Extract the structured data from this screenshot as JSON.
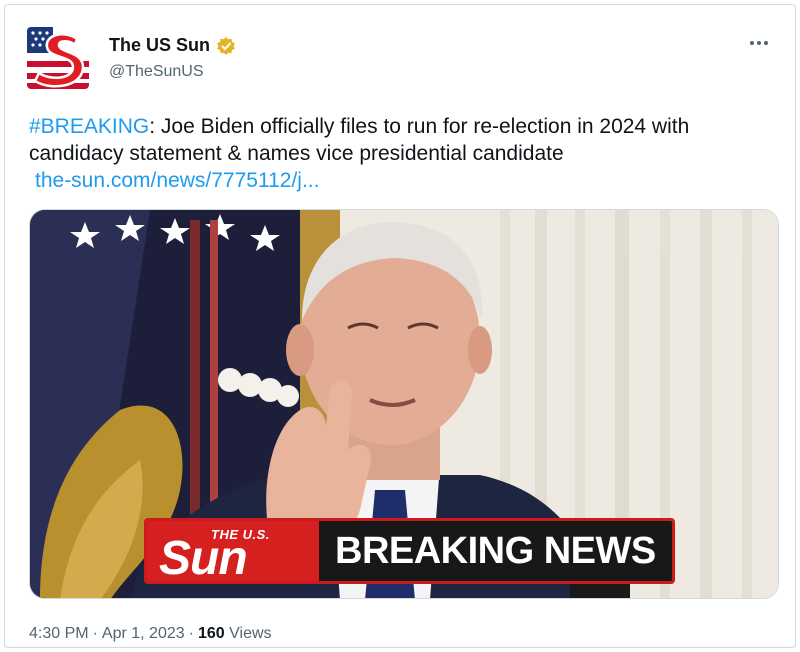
{
  "author": {
    "name": "The US Sun",
    "handle": "@TheSunUS",
    "verified_color": "#f4c542"
  },
  "tweet": {
    "hashtag": "#BREAKING",
    "text": ": Joe Biden officially files to run for re-election in 2024 with candidacy statement & names vice presidential candidate",
    "link": "the-sun.com/news/7775112/j..."
  },
  "media": {
    "banner_logo_small": "THE U.S.",
    "banner_logo_big": "Sun",
    "banner_text": "BREAKING NEWS"
  },
  "meta": {
    "time": "4:30 PM",
    "date": "Apr 1, 2023",
    "views_count": "160",
    "views_label": "Views"
  },
  "colors": {
    "link": "#1d9bf0",
    "banner_red": "#d62020",
    "banner_dark": "#181818"
  },
  "icons": [
    "sun-logo-icon",
    "verified-badge-icon",
    "more-options-icon"
  ]
}
